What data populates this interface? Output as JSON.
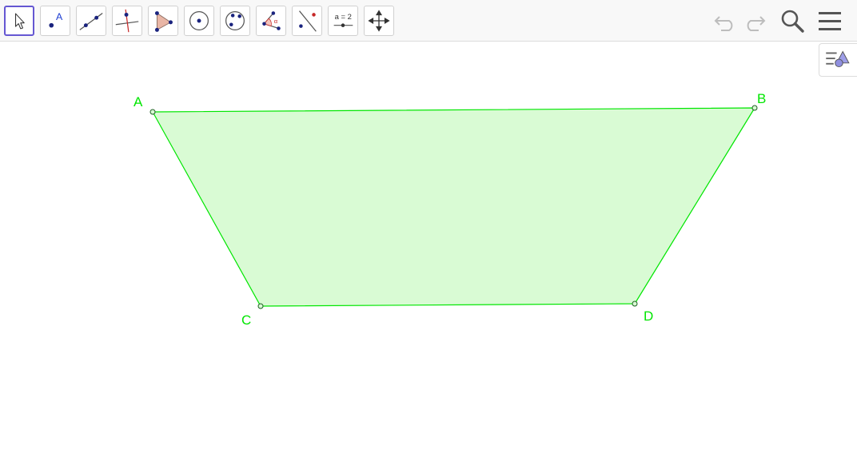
{
  "toolbar": {
    "tools": [
      {
        "id": "move",
        "icon": "move-arrow-icon",
        "active": true
      },
      {
        "id": "point",
        "icon": "point-icon",
        "glyph": "A"
      },
      {
        "id": "line",
        "icon": "line-through-points-icon"
      },
      {
        "id": "perpendicular",
        "icon": "perpendicular-line-icon"
      },
      {
        "id": "polygon",
        "icon": "polygon-icon"
      },
      {
        "id": "circle",
        "icon": "circle-center-point-icon"
      },
      {
        "id": "circle3",
        "icon": "circle-three-points-icon"
      },
      {
        "id": "angle",
        "icon": "angle-icon",
        "glyph": "α"
      },
      {
        "id": "reflect",
        "icon": "reflect-about-line-icon"
      },
      {
        "id": "slider",
        "icon": "slider-icon",
        "glyph": "a = 2"
      },
      {
        "id": "move-view",
        "icon": "move-graphics-view-icon"
      }
    ],
    "right": [
      "undo-icon",
      "redo-icon",
      "search-icon",
      "menu-icon"
    ]
  },
  "colors": {
    "accent": "#6557d2",
    "polygon_stroke": "#00e600",
    "polygon_fill": "#d9fbd4",
    "label": "#00e600"
  },
  "polygon": {
    "vertices": [
      {
        "label": "A"
      },
      {
        "label": "B"
      },
      {
        "label": "C"
      },
      {
        "label": "D"
      }
    ]
  }
}
